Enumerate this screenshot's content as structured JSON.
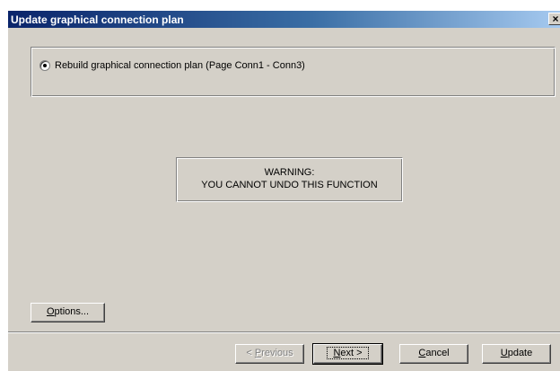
{
  "window": {
    "title": "Update graphical connection plan",
    "close_glyph": "×"
  },
  "options_group": {
    "radio_label": "Rebuild graphical connection plan (Page Conn1 - Conn3)",
    "radio_selected": true
  },
  "warning": {
    "line1": "WARNING:",
    "line2": "YOU CANNOT UNDO THIS FUNCTION"
  },
  "buttons": {
    "options": {
      "label_accel": "O",
      "label_rest": "ptions..."
    },
    "previous": {
      "label_pre": "< ",
      "label_accel": "P",
      "label_rest": "revious",
      "enabled": false
    },
    "next": {
      "label_accel": "N",
      "label_rest": "ext >"
    },
    "cancel": {
      "label_accel": "C",
      "label_rest": "ancel"
    },
    "update": {
      "label_accel": "U",
      "label_rest": "pdate"
    }
  },
  "colors": {
    "dialog_face": "#d4d0c8",
    "title_start": "#0a246a",
    "title_end": "#a6caf0"
  }
}
